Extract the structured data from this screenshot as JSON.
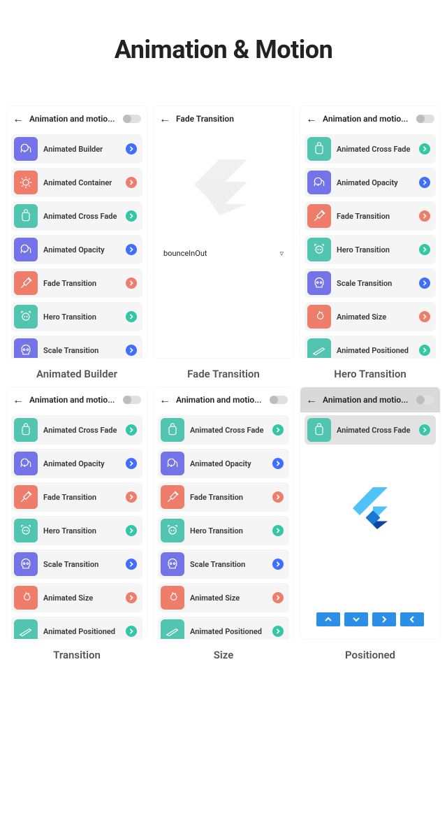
{
  "page_title": "Animation & Motion",
  "captions": [
    "Animated Builder",
    "Fade Transition",
    "Hero Transition",
    "Transition",
    "Size",
    "Positioned"
  ],
  "appbar_long": "Animation and motio...",
  "appbar_fade": "Fade Transition",
  "colors": {
    "purple": "#7474e8",
    "coral": "#ee7e6b",
    "teal": "#52c5b0",
    "blue_badge": "#3f6fff"
  },
  "fade_dropdown": "bounceInOut",
  "screens": {
    "s1": [
      {
        "icon": "elephant",
        "box": "purple",
        "label": "Animated Builder",
        "chev": "blue"
      },
      {
        "icon": "lion",
        "box": "coral",
        "label": "Animated Container",
        "chev": "coral"
      },
      {
        "icon": "backpack",
        "box": "teal",
        "label": "Animated Cross Fade",
        "chev": "teal"
      },
      {
        "icon": "elephant",
        "box": "purple",
        "label": "Animated Opacity",
        "chev": "blue"
      },
      {
        "icon": "syringe",
        "box": "coral",
        "label": "Fade Transition",
        "chev": "coral"
      },
      {
        "icon": "cow",
        "box": "teal",
        "label": "Hero Transition",
        "chev": "teal"
      },
      {
        "icon": "skull",
        "box": "purple",
        "label": "Scale Transition",
        "chev": "blue"
      }
    ],
    "s3": [
      {
        "icon": "backpack",
        "box": "teal",
        "label": "Animated Cross Fade",
        "chev": "teal"
      },
      {
        "icon": "elephant",
        "box": "purple",
        "label": "Animated Opacity",
        "chev": "blue"
      },
      {
        "icon": "syringe",
        "box": "coral",
        "label": "Fade Transition",
        "chev": "coral"
      },
      {
        "icon": "cow",
        "box": "teal",
        "label": "Hero Transition",
        "chev": "teal"
      },
      {
        "icon": "skull",
        "box": "purple",
        "label": "Scale Transition",
        "chev": "blue"
      },
      {
        "icon": "fire",
        "box": "coral",
        "label": "Animated Size",
        "chev": "coral"
      },
      {
        "icon": "rifle",
        "box": "teal",
        "label": "Animated Positioned",
        "chev": "teal"
      }
    ],
    "s6_item": {
      "icon": "backpack",
      "box": "teal",
      "label": "Animated Cross Fade",
      "chev": "teal"
    }
  },
  "pos_buttons": [
    "up",
    "down",
    "right",
    "left"
  ]
}
